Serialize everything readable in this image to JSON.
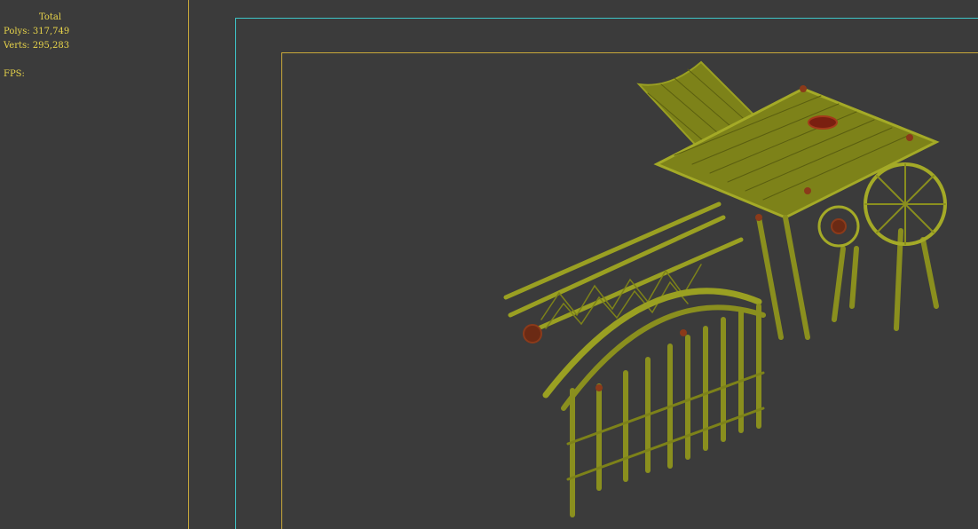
{
  "stats": {
    "total_label": "Total",
    "polys_label": "Polys:",
    "polys_value": "317,749",
    "verts_label": "Verts:",
    "verts_value": "295,283",
    "fps_label": "FPS:"
  },
  "colors": {
    "viewport_bg": "#3b3b3b",
    "stats_text": "#e8d44a",
    "safe_frame": "#3ec5c8",
    "render_frame": "#c8a83a",
    "bamboo": "#8a8f1e",
    "rope": "#8b3a1a"
  }
}
